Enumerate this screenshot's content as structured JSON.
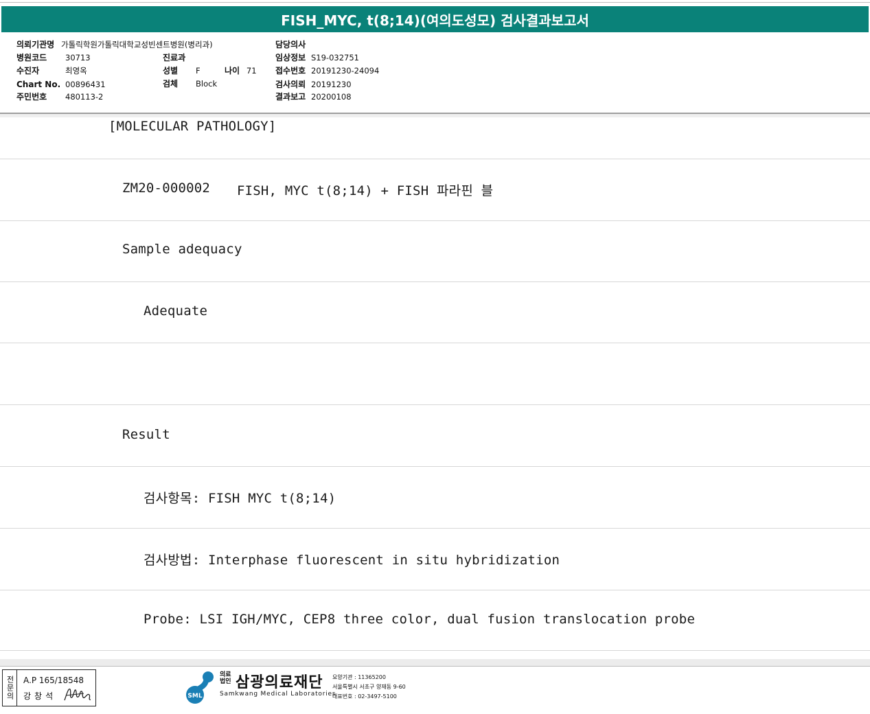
{
  "report": {
    "title": "FISH_MYC, t(8;14)(여의도성모) 검사결과보고서"
  },
  "header": {
    "requesting_institution": {
      "label": "의뢰기관명",
      "value": "가톨릭학원가톨릭대학교성빈센트병원(병리과)"
    },
    "hospital_code": {
      "label": "병원코드",
      "value": "30713"
    },
    "patient": {
      "label": "수진자",
      "value": "최영옥"
    },
    "chart_no": {
      "label": "Chart No.",
      "value": "00896431"
    },
    "resident_no": {
      "label": "주민번호",
      "value": "480113-2"
    },
    "department": {
      "label": "진료과",
      "value": ""
    },
    "sex": {
      "label": "성별",
      "value": "F"
    },
    "age": {
      "label": "나이",
      "value": "71"
    },
    "specimen": {
      "label": "검체",
      "value": "Block"
    },
    "doctor": {
      "label": "담당의사",
      "value": ""
    },
    "clinical_info": {
      "label": "임상정보",
      "value": "S19-032751"
    },
    "receipt_no": {
      "label": "접수번호",
      "value": "20191230-24094"
    },
    "test_request": {
      "label": "검사의뢰",
      "value": "20191230"
    },
    "result_report": {
      "label": "결과보고",
      "value": "20200108"
    }
  },
  "body": {
    "section": "[MOLECULAR PATHOLOGY]",
    "test_code": "ZM20-000002",
    "test_name": "FISH, MYC t(8;14) + FISH 파라핀 블",
    "sample_adequacy_heading": "Sample adequacy",
    "sample_adequacy_value": "Adequate",
    "result_heading": "Result",
    "test_item": "검사항목: FISH MYC t(8;14)",
    "test_method": "검사방법: Interphase fluorescent in situ hybridization",
    "probe": "Probe: LSI IGH/MYC, CEP8 three color, dual fusion translocation probe"
  },
  "footer": {
    "sign_side": "전문의",
    "ap_number": "A.P 165/18548",
    "physician": "강창석",
    "org_prefix": "의료법인",
    "org_name": "삼광의료재단",
    "org_english": "Samkwang Medical Laboratories",
    "logo_text": "SML",
    "care_code": "요양기관 : 11365200",
    "address": "서울특별시 서초구 양재동 9-60",
    "phone": "대표번호 : 02-3497-5100",
    "brand_color": "#0a8279",
    "logo_color": "#1a7fb5"
  }
}
